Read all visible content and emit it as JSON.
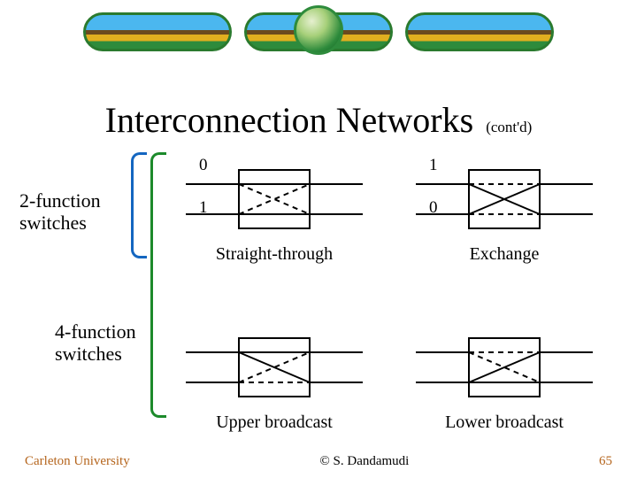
{
  "header": {
    "title": "Interconnection Networks",
    "contd": "(cont'd)"
  },
  "labels": {
    "two_func_l1": "2-function",
    "two_func_l2": "switches",
    "four_func_l1": "4-function",
    "four_func_l2": "switches"
  },
  "figures": {
    "straight": {
      "caption": "Straight-through",
      "port_top": "0",
      "port_bottom": "1"
    },
    "exchange": {
      "caption": "Exchange",
      "port_top": "1",
      "port_bottom": "0"
    },
    "upper": {
      "caption": "Upper broadcast"
    },
    "lower": {
      "caption": "Lower broadcast"
    }
  },
  "footer": {
    "university": "Carleton University",
    "copyright": "© S. Dandamudi",
    "page": "65"
  }
}
